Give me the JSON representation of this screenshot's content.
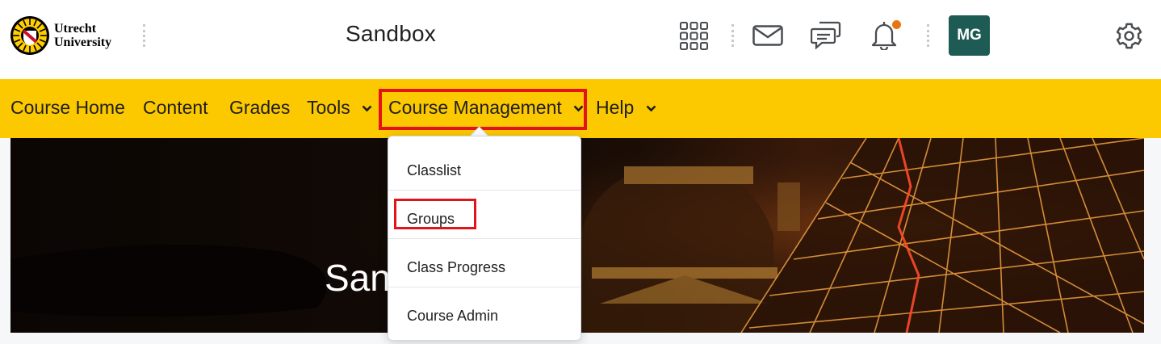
{
  "header": {
    "logo_line1": "Utrecht",
    "logo_line2": "University",
    "course_title": "Sandbox",
    "avatar_initials": "MG",
    "icons": [
      "apps-grid-icon",
      "mail-icon",
      "chat-icon",
      "bell-icon",
      "gear-icon"
    ],
    "notification_dot_color": "#e87511",
    "avatar_color": "#1e5b54"
  },
  "nav": {
    "background_color": "#fcc900",
    "items": [
      {
        "label": "Course Home"
      },
      {
        "label": "Content"
      },
      {
        "label": "Grades"
      },
      {
        "label": "Tools",
        "has_dropdown": true
      },
      {
        "label": "Course Management",
        "has_dropdown": true,
        "highlighted": true
      },
      {
        "label": "Help",
        "has_dropdown": true
      }
    ],
    "highlight_color": "#e3131b"
  },
  "banner": {
    "title": "San"
  },
  "dropdown": {
    "items": [
      {
        "label": "Classlist"
      },
      {
        "label": "Groups",
        "highlighted": true
      },
      {
        "label": "Class Progress"
      },
      {
        "label": "Course Admin"
      }
    ]
  }
}
